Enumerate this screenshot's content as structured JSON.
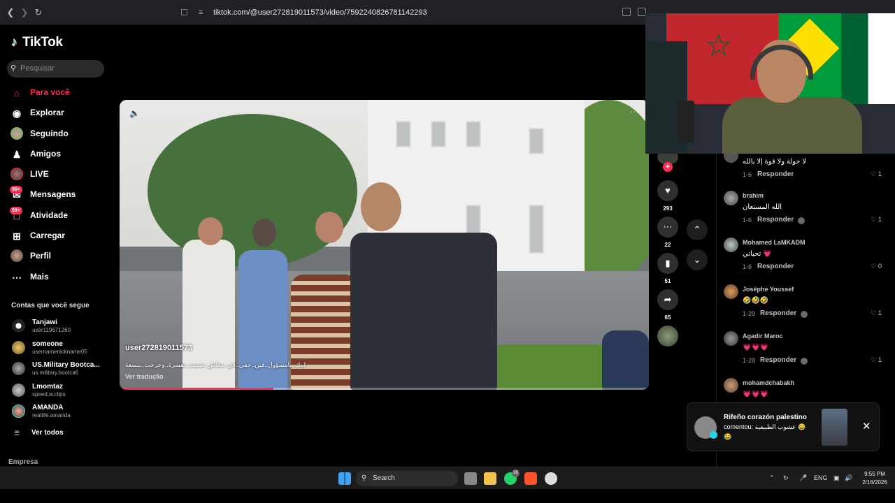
{
  "browser": {
    "url": "tiktok.com/@user272819011573/video/7592240826781142293"
  },
  "sidebar": {
    "logo": "TikTok",
    "search_placeholder": "Pesquisar",
    "menu": [
      {
        "label": "Para você",
        "icon": "home-icon",
        "active": true
      },
      {
        "label": "Explorar",
        "icon": "compass-icon"
      },
      {
        "label": "Seguindo",
        "icon": "following-avatar-icon"
      },
      {
        "label": "Amigos",
        "icon": "friends-icon"
      },
      {
        "label": "LIVE",
        "icon": "live-icon"
      },
      {
        "label": "Mensagens",
        "icon": "messages-icon",
        "badge": "99+"
      },
      {
        "label": "Atividade",
        "icon": "activity-icon",
        "badge": "99+"
      },
      {
        "label": "Carregar",
        "icon": "upload-icon"
      },
      {
        "label": "Perfil",
        "icon": "profile-avatar-icon"
      },
      {
        "label": "Mais",
        "icon": "more-icon"
      }
    ],
    "following_heading": "Contas que você segue",
    "following": [
      {
        "name": "Tanjawi",
        "username": "user119671260"
      },
      {
        "name": "someone",
        "username": "usernamenickname05"
      },
      {
        "name": "US.Military Bootca...",
        "username": "us.military.bootca6"
      },
      {
        "name": "Lmomtaz",
        "username": "speed.w.clips"
      },
      {
        "name": "AMANDA",
        "username": "reallife.amanda"
      }
    ],
    "see_all": "Ver todos",
    "company": "Empresa"
  },
  "video": {
    "username": "user272819011573",
    "caption": "اينك..بامسؤول..فين..حقي..في..معاش..سنيت..بعشرة..وخرجت..بتسعة",
    "translate": "Ver tradução",
    "progress": 0.29
  },
  "actions": {
    "likes": "293",
    "comments": "22",
    "saves": "51",
    "shares": "65"
  },
  "comments": [
    {
      "name": "",
      "text": "لا حولة ولا قوة إلا بالله",
      "date": "1-6",
      "reply": "Responder",
      "likes": "1"
    },
    {
      "name": "brahim",
      "text": "الله المستعان",
      "date": "1-6",
      "reply": "Responder",
      "likes": "1"
    },
    {
      "name": "Mohamed LaMKADM",
      "text": "تحياتي 💗",
      "date": "1-6",
      "reply": "Responder",
      "likes": "0"
    },
    {
      "name": "Josèphe Youssef",
      "text": "🤣🤣🤣",
      "date": "1-29",
      "reply": "Responder",
      "likes": "1"
    },
    {
      "name": "Agadir Maroc",
      "text": "💗💗💗",
      "date": "1-28",
      "reply": "Responder",
      "likes": "1"
    },
    {
      "name": "mohamdchabakh",
      "text": "💗💗💗",
      "date": "",
      "reply": "",
      "likes": ""
    }
  ],
  "notification": {
    "name": "Rifeño corazón palestino",
    "message": "comentou: عشوب الطبيعية 😂",
    "message2": "😂"
  },
  "taskbar": {
    "search": "Search",
    "whatsapp_badge": "16",
    "language": "ENG",
    "time": "9:55 PM",
    "date": "2/16/2026"
  }
}
